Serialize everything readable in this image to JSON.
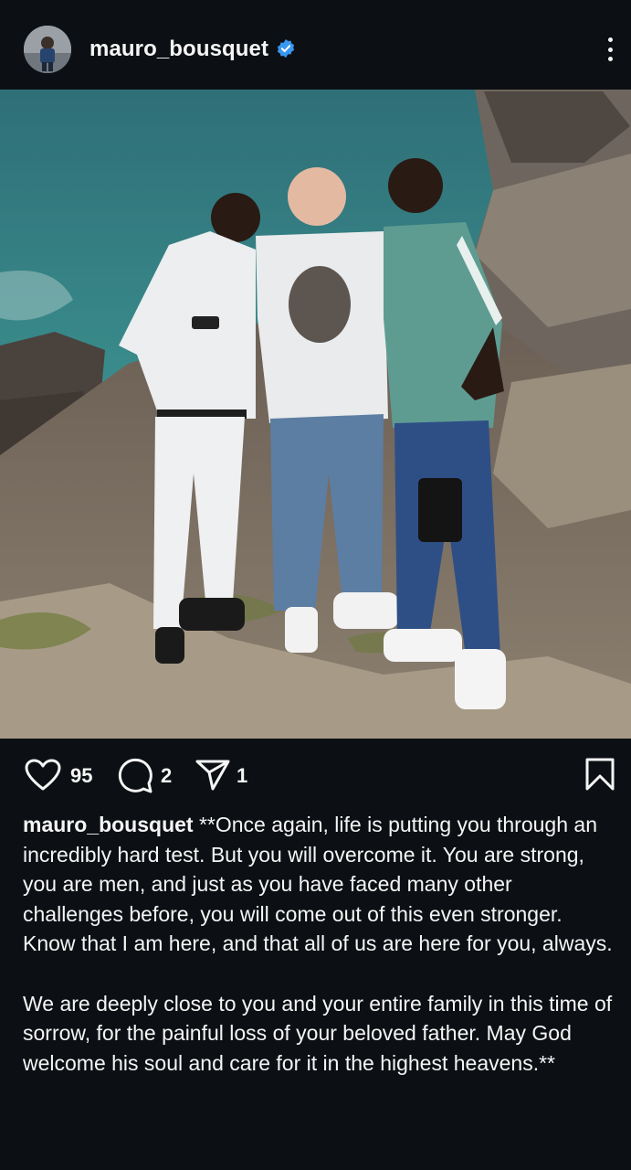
{
  "post": {
    "username": "mauro_bousquet",
    "verified": true
  },
  "actions": {
    "likes": "95",
    "comments": "2",
    "shares": "1"
  },
  "caption": {
    "username": "mauro_bousquet",
    "lines": [
      " **Once again, life is putting you through an incredibly hard test. But you will overcome it. You are strong, you are men, and just as you have faced many other challenges before, you will come out of this even stronger.",
      "Know that I am here, and that all of us are here for you, always.",
      "",
      "We are deeply close to you and your entire family in this time of sorrow, for the painful loss of your beloved father. May God welcome his soul and care for it in the highest heavens.**"
    ]
  },
  "icons": {
    "like": "heart-icon",
    "comment": "comment-bubble-icon",
    "share": "paper-plane-icon",
    "save": "bookmark-icon",
    "more": "more-options-icon",
    "verified": "verified-badge-icon"
  },
  "colors": {
    "background": "#0c1014",
    "text": "#f5f5f5",
    "verified": "#3897f0"
  }
}
